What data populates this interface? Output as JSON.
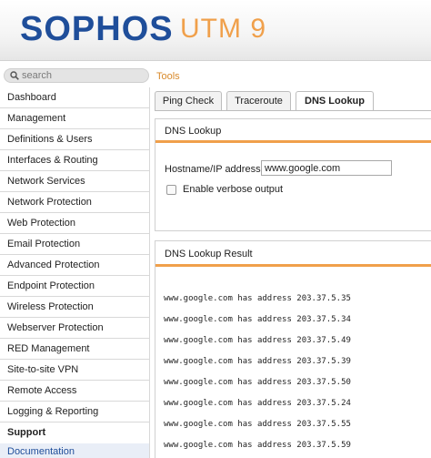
{
  "header": {
    "logo": "SOPHOS",
    "product": "UTM 9"
  },
  "search": {
    "placeholder": "search"
  },
  "breadcrumb": "Tools",
  "sidebar": {
    "items": [
      "Dashboard",
      "Management",
      "Definitions & Users",
      "Interfaces & Routing",
      "Network Services",
      "Network Protection",
      "Web Protection",
      "Email Protection",
      "Advanced Protection",
      "Endpoint Protection",
      "Wireless Protection",
      "Webserver Protection",
      "RED Management",
      "Site-to-site VPN",
      "Remote Access",
      "Logging & Reporting"
    ],
    "section": "Support",
    "sub_item": "Documentation"
  },
  "tabs": [
    "Ping Check",
    "Traceroute",
    "DNS Lookup"
  ],
  "active_tab": "DNS Lookup",
  "lookup": {
    "title": "DNS Lookup",
    "host_label": "Hostname/IP address:",
    "host_value": "www.google.com",
    "verbose_label": "Enable verbose output",
    "verbose_checked": false
  },
  "result": {
    "title": "DNS Lookup Result",
    "lines": [
      "www.google.com has address 203.37.5.35",
      "www.google.com has address 203.37.5.34",
      "www.google.com has address 203.37.5.49",
      "www.google.com has address 203.37.5.39",
      "www.google.com has address 203.37.5.50",
      "www.google.com has address 203.37.5.24",
      "www.google.com has address 203.37.5.55",
      "www.google.com has address 203.37.5.59"
    ]
  },
  "colors": {
    "brand_blue": "#1f4e9a",
    "accent_orange": "#f0a04b"
  }
}
